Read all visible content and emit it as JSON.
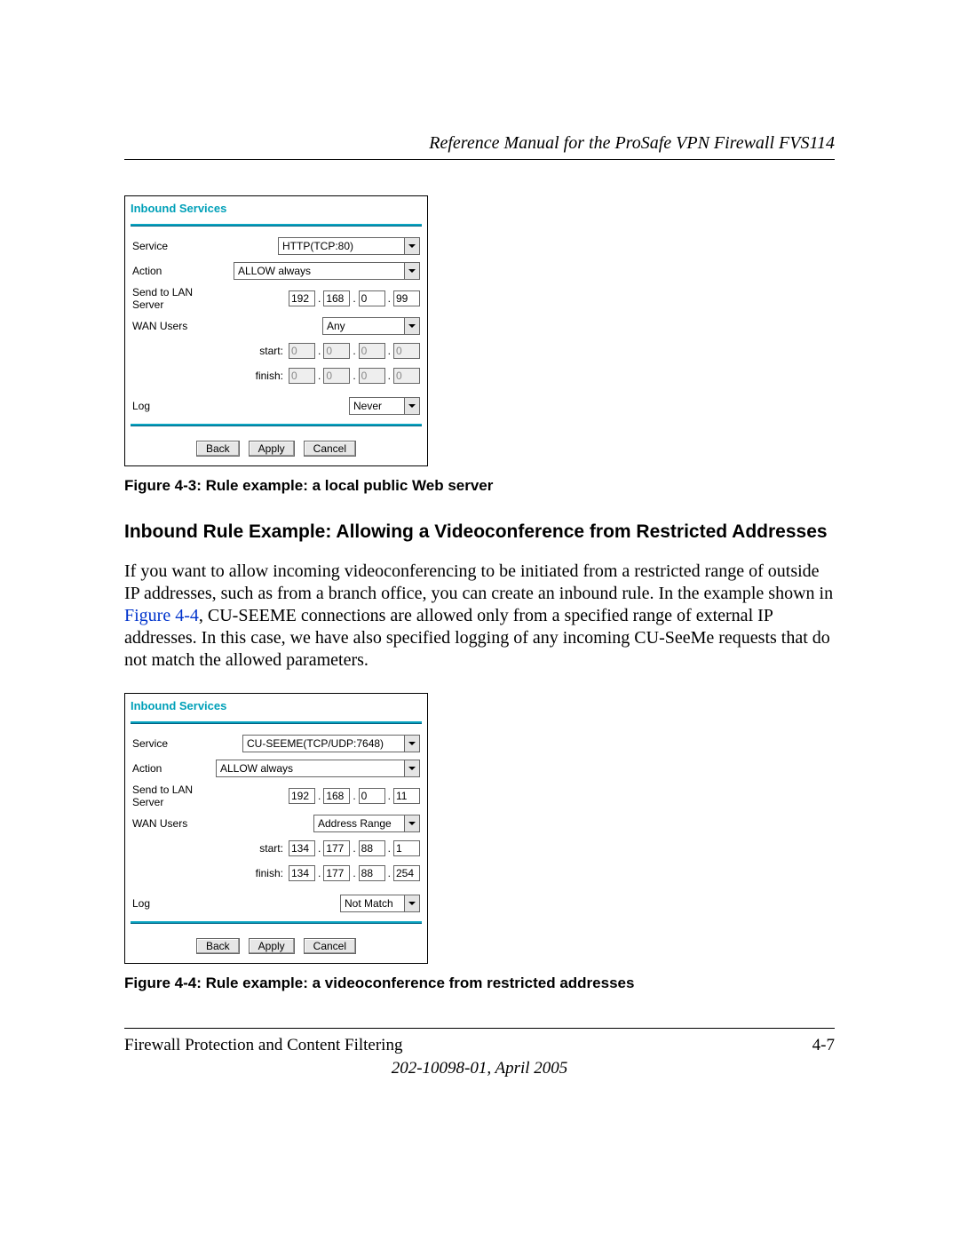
{
  "header": {
    "running_title": "Reference Manual for the ProSafe VPN Firewall FVS114"
  },
  "panel_title": "Inbound Services",
  "labels": {
    "service": "Service",
    "action": "Action",
    "send_to": "Send to LAN Server",
    "wan_users": "WAN Users",
    "start": "start:",
    "finish": "finish:",
    "log": "Log"
  },
  "buttons": {
    "back": "Back",
    "apply": "Apply",
    "cancel": "Cancel"
  },
  "fig43": {
    "service": "HTTP(TCP:80)",
    "action": "ALLOW always",
    "lan_ip": [
      "192",
      "168",
      "0",
      "99"
    ],
    "wan_users": "Any",
    "start": [
      "0",
      "0",
      "0",
      "0"
    ],
    "finish": [
      "0",
      "0",
      "0",
      "0"
    ],
    "start_disabled": true,
    "finish_disabled": true,
    "log": "Never",
    "caption": "Figure 4-3:  Rule example: a local public Web server"
  },
  "section": {
    "heading": "Inbound Rule Example: Allowing a Videoconference from Restricted Addresses",
    "para_part1": "If you want to allow incoming videoconferencing to be initiated from a restricted range of outside IP addresses, such as from a branch office, you can create an inbound rule. In the example shown in ",
    "link_text": "Figure 4-4",
    "para_part2": ", CU-SEEME connections are allowed only from a specified range of external IP addresses. In this case, we have also specified logging of any incoming CU-SeeMe requests that do not match the allowed parameters."
  },
  "fig44": {
    "service": "CU-SEEME(TCP/UDP:7648)",
    "action": "ALLOW always",
    "lan_ip": [
      "192",
      "168",
      "0",
      "11"
    ],
    "wan_users": "Address Range",
    "start": [
      "134",
      "177",
      "88",
      "1"
    ],
    "finish": [
      "134",
      "177",
      "88",
      "254"
    ],
    "start_disabled": false,
    "finish_disabled": false,
    "log": "Not Match",
    "caption": "Figure 4-4:  Rule example: a videoconference from restricted addresses"
  },
  "footer": {
    "left": "Firewall Protection and Content Filtering",
    "right": "4-7",
    "docnum": "202-10098-01, April 2005"
  }
}
